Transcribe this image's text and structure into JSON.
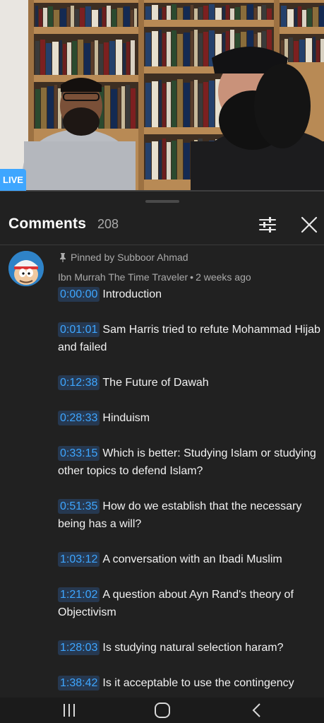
{
  "video": {
    "live_label": "LIVE"
  },
  "comments_sheet": {
    "title": "Comments",
    "count": "208",
    "filter_icon": "sliders-icon",
    "close_icon": "close-icon",
    "pinned_comment": {
      "pinned_label": "Pinned by Subboor Ahmad",
      "author": "Ibn Murrah The Time Traveler",
      "separator": "•",
      "time_ago": "2 weeks ago",
      "chapters": [
        {
          "time": "0:00:00",
          "text": "Introduction"
        },
        {
          "time": "0:01:01",
          "text": "Sam Harris tried to refute Mohammad Hijab and failed"
        },
        {
          "time": "0:12:38",
          "text": "The Future of Dawah"
        },
        {
          "time": "0:28:33",
          "text": "Hinduism"
        },
        {
          "time": "0:33:15",
          "text": "Which is better: Studying Islam or studying other topics to defend Islam?"
        },
        {
          "time": "0:51:35",
          "text": "How do we establish that the necessary being has a will?"
        },
        {
          "time": "1:03:12",
          "text": "A conversation with an Ibadi Muslim"
        },
        {
          "time": "1:21:02",
          "text": "A question about Ayn Rand's theory of Objectivism"
        },
        {
          "time": "1:28:03",
          "text": "Is studying natural selection haram?"
        },
        {
          "time": "1:38:42",
          "text": "Is it acceptable to use the contingency"
        }
      ]
    }
  },
  "navbar": {
    "items": [
      "recent-apps-icon",
      "home-icon",
      "back-icon"
    ]
  }
}
